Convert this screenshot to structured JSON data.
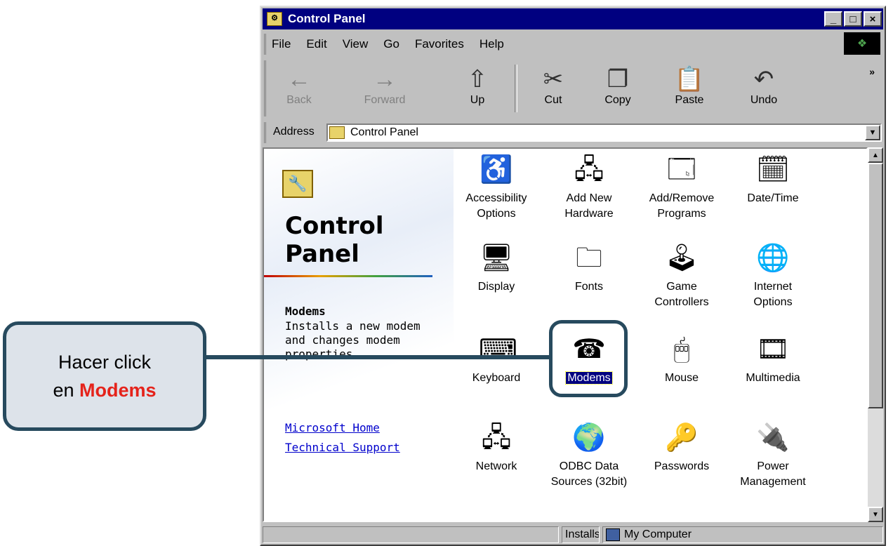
{
  "window": {
    "title": "Control Panel",
    "controls": {
      "minimize": "_",
      "maximize": "□",
      "close": "×"
    }
  },
  "menu": [
    "File",
    "Edit",
    "View",
    "Go",
    "Favorites",
    "Help"
  ],
  "toolbar": {
    "back": "Back",
    "forward": "Forward",
    "up": "Up",
    "cut": "Cut",
    "copy": "Copy",
    "paste": "Paste",
    "undo": "Undo",
    "more": "»"
  },
  "address": {
    "label": "Address",
    "value": "Control Panel"
  },
  "left_pane": {
    "title_line1": "Control",
    "title_line2": "Panel",
    "selected_title": "Modems",
    "selected_desc": "Installs a new modem and changes modem properties.",
    "links": [
      "Microsoft Home",
      "Technical Support"
    ]
  },
  "icons": [
    {
      "label1": "Accessibility",
      "label2": "Options",
      "icon": "accessibility-icon"
    },
    {
      "label1": "Add New",
      "label2": "Hardware",
      "icon": "add-hardware-icon"
    },
    {
      "label1": "Add/Remove",
      "label2": "Programs",
      "icon": "add-remove-programs-icon"
    },
    {
      "label1": "Date/Time",
      "label2": "",
      "icon": "date-time-icon"
    },
    {
      "label1": "Display",
      "label2": "",
      "icon": "display-icon"
    },
    {
      "label1": "Fonts",
      "label2": "",
      "icon": "fonts-icon"
    },
    {
      "label1": "Game",
      "label2": "Controllers",
      "icon": "game-controllers-icon"
    },
    {
      "label1": "Internet",
      "label2": "Options",
      "icon": "internet-options-icon"
    },
    {
      "label1": "Keyboard",
      "label2": "",
      "icon": "keyboard-icon"
    },
    {
      "label1": "Modems",
      "label2": "",
      "icon": "modem-phone-icon"
    },
    {
      "label1": "Mouse",
      "label2": "",
      "icon": "mouse-icon"
    },
    {
      "label1": "Multimedia",
      "label2": "",
      "icon": "multimedia-icon"
    },
    {
      "label1": "Network",
      "label2": "",
      "icon": "network-icon"
    },
    {
      "label1": "ODBC Data",
      "label2": "Sources (32bit)",
      "icon": "odbc-icon"
    },
    {
      "label1": "Passwords",
      "label2": "",
      "icon": "passwords-keys-icon"
    },
    {
      "label1": "Power",
      "label2": "Management",
      "icon": "power-management-icon"
    }
  ],
  "status": {
    "text": "Installs a",
    "zone": "My Computer"
  },
  "callout": {
    "line1": "Hacer click",
    "line2_prefix": "en",
    "line2_highlight": "Modems",
    "highlight_color": "#e5231b"
  }
}
